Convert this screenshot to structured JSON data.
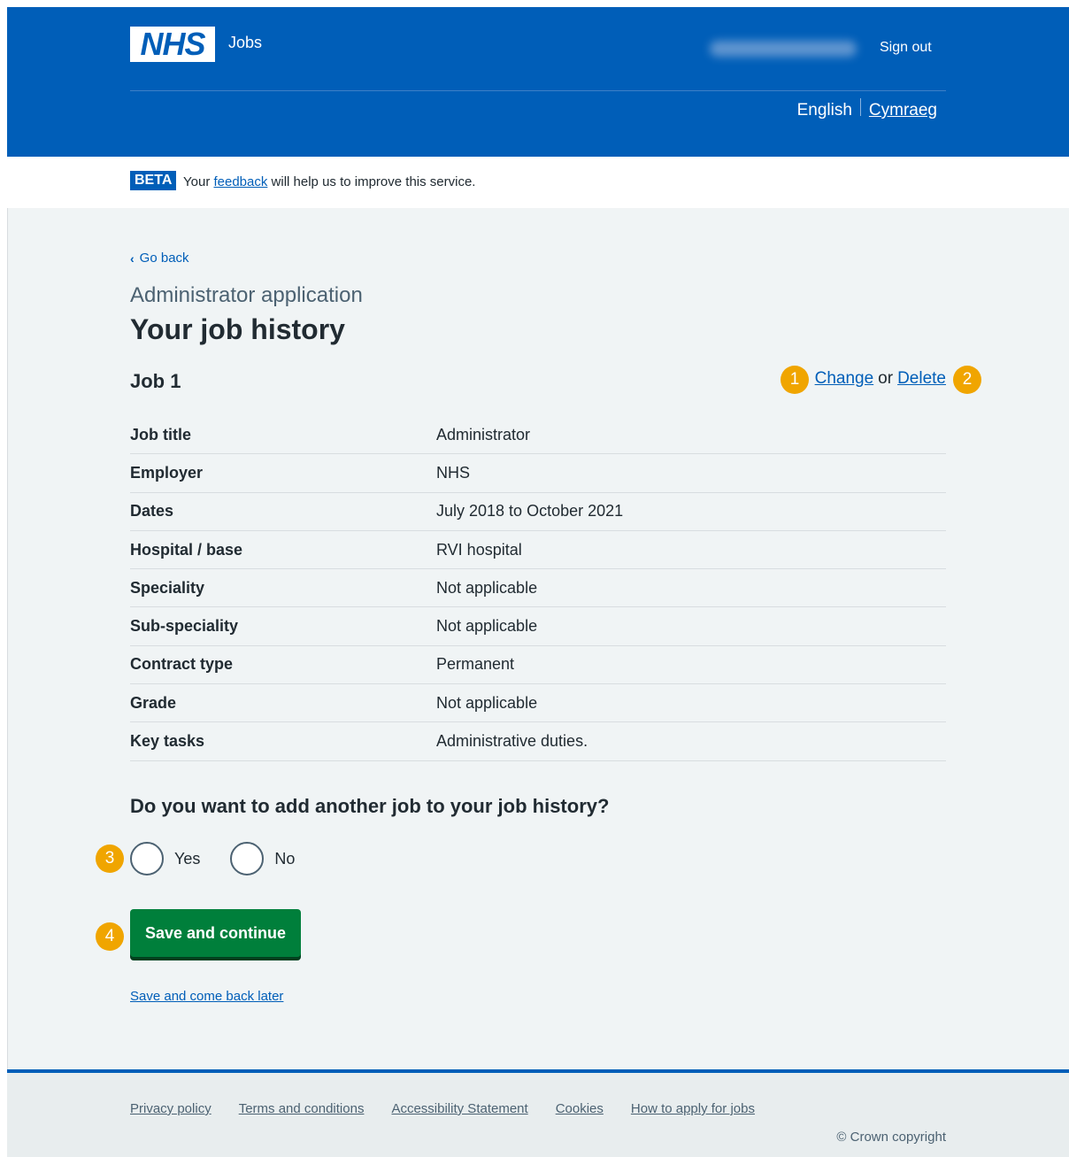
{
  "header": {
    "logo": "NHS",
    "service_name": "Jobs",
    "sign_out": "Sign out",
    "lang_english": "English",
    "lang_welsh": "Cymraeg"
  },
  "beta": {
    "tag": "BETA",
    "prefix": "Your",
    "link": "feedback",
    "suffix": "will help us to improve this service."
  },
  "main": {
    "back": "Go back",
    "caption": "Administrator application",
    "title": "Your job history",
    "job_heading": "Job 1",
    "change": "Change",
    "or": "or",
    "delete": "Delete",
    "rows": [
      {
        "key": "Job title",
        "value": "Administrator"
      },
      {
        "key": "Employer",
        "value": "NHS"
      },
      {
        "key": "Dates",
        "value": "July 2018 to October 2021"
      },
      {
        "key": "Hospital / base",
        "value": "RVI hospital"
      },
      {
        "key": "Speciality",
        "value": "Not applicable"
      },
      {
        "key": "Sub-speciality",
        "value": "Not applicable"
      },
      {
        "key": "Contract type",
        "value": "Permanent"
      },
      {
        "key": "Grade",
        "value": "Not applicable"
      },
      {
        "key": "Key tasks",
        "value": "Administrative duties."
      }
    ],
    "question": "Do you want to add another job to your job history?",
    "radio_yes": "Yes",
    "radio_no": "No",
    "save_continue": "Save and continue",
    "save_later": "Save and come back later"
  },
  "markers": [
    "1",
    "2",
    "3",
    "4"
  ],
  "footer": {
    "links": [
      "Privacy policy",
      "Terms and conditions",
      "Accessibility Statement",
      "Cookies",
      "How to apply for jobs"
    ],
    "copyright": "© Crown copyright"
  },
  "colors": {
    "nhs_blue": "#005eb8",
    "green": "#007f3b",
    "marker": "#f0a500",
    "background": "#f0f4f5"
  }
}
